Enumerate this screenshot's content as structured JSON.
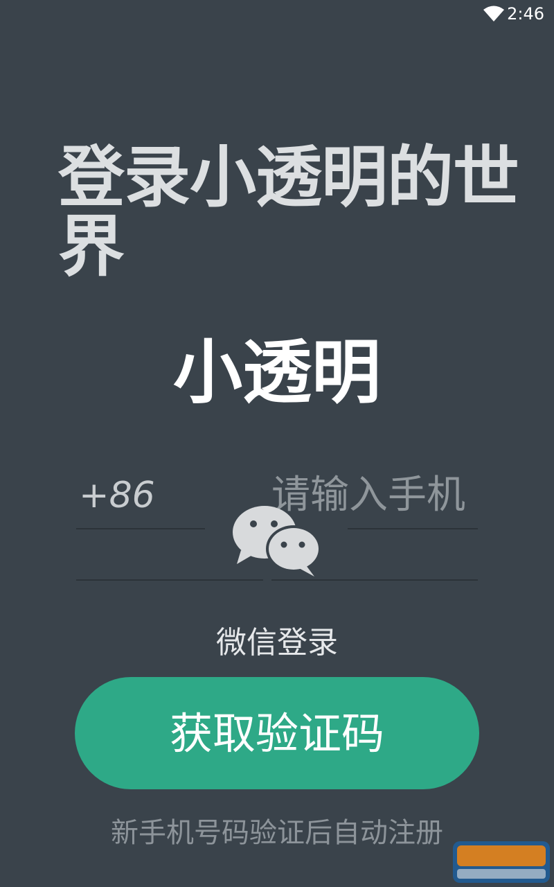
{
  "status_bar": {
    "time": "2:46",
    "wifi_icon": "wifi-icon"
  },
  "headline": "登录小透明的世界",
  "app_name": "小透明",
  "phone": {
    "country_code": "+86",
    "placeholder": "请输入手机"
  },
  "wechat": {
    "icon": "wechat-icon",
    "label": "微信登录"
  },
  "get_code_button": "获取验证码",
  "footer_note": "新手机号码验证后自动注册",
  "colors": {
    "background": "#3a434b",
    "button": "#2ea987",
    "headline": "#dcdfe1"
  }
}
